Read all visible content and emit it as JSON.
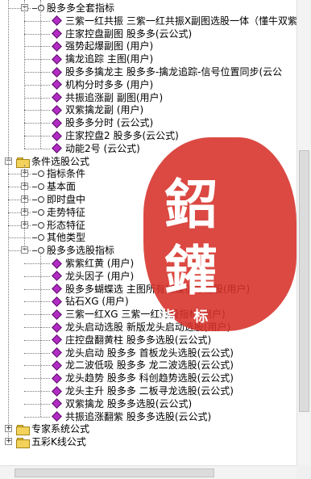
{
  "tree": {
    "items": [
      {
        "label": "股多多全套指标",
        "level": 1,
        "icon": "ring-icon",
        "expand": "−"
      },
      {
        "label": "三紫一红共振   三紫一红共振X副图选股一体（懂牛双紫",
        "level": 2,
        "icon": "diamond-icon"
      },
      {
        "label": "庄家控盘副图   股多多(云公式)",
        "level": 2,
        "icon": "diamond-icon"
      },
      {
        "label": "强势起爆副图  (用户)",
        "level": 2,
        "icon": "diamond-icon"
      },
      {
        "label": "擒龙追踪   主图(用户)",
        "level": 2,
        "icon": "diamond-icon"
      },
      {
        "label": "股多多擒龙主   股多多-擒龙追踪-信号位置同步(云公",
        "level": 2,
        "icon": "diamond-icon"
      },
      {
        "label": "机构分时多多   (用户)",
        "level": 2,
        "icon": "diamond-icon"
      },
      {
        "label": "共振追涨副   副图(用户)",
        "level": 2,
        "icon": "diamond-icon"
      },
      {
        "label": "双紫擒龙副   (用户)",
        "level": 2,
        "icon": "diamond-icon"
      },
      {
        "label": "股多多分时   (云公式)",
        "level": 2,
        "icon": "diamond-icon"
      },
      {
        "label": "庄家控盘2   股多多(云公式)",
        "level": 2,
        "icon": "diamond-icon"
      },
      {
        "label": "动能2号   (云公式)",
        "level": 2,
        "icon": "diamond-icon"
      },
      {
        "label": "条件选股公式",
        "level": 0,
        "icon": "folder-icon",
        "expand": "−"
      },
      {
        "label": "指标条件",
        "level": 1,
        "icon": "ring-icon",
        "expand": "+"
      },
      {
        "label": "基本面",
        "level": 1,
        "icon": "ring-icon",
        "expand": "+"
      },
      {
        "label": "即时盘中",
        "level": 1,
        "icon": "ring-icon",
        "expand": "+"
      },
      {
        "label": "走势特征",
        "level": 1,
        "icon": "ring-icon",
        "expand": "+"
      },
      {
        "label": "形态特征",
        "level": 1,
        "icon": "ring-icon",
        "expand": "+"
      },
      {
        "label": "其他类型",
        "level": 1,
        "icon": "ring-icon"
      },
      {
        "label": "股多多选股指标",
        "level": 1,
        "icon": "ring-icon",
        "expand": "−"
      },
      {
        "label": "紫紫红黄   (用户)",
        "level": 2,
        "icon": "diamond-icon"
      },
      {
        "label": "龙头因子   (用户)",
        "level": 2,
        "icon": "diamond-icon"
      },
      {
        "label": "股多多蝴蝶选   主图所有蝴蝶信号选股(用户)",
        "level": 2,
        "icon": "diamond-icon"
      },
      {
        "label": "钻石XG   (用户)",
        "level": 2,
        "icon": "diamond-icon"
      },
      {
        "label": "三紫一红XG   三紫一红选股指标(用户)",
        "level": 2,
        "icon": "diamond-icon"
      },
      {
        "label": "龙头启动选股   新版龙头启动选股(用户)",
        "level": 2,
        "icon": "diamond-icon"
      },
      {
        "label": "庄控盘翻黄柱   股多多选股(云公式)",
        "level": 2,
        "icon": "diamond-icon"
      },
      {
        "label": "龙头启动   股多多 首板龙头选股(云公式)",
        "level": 2,
        "icon": "diamond-icon"
      },
      {
        "label": "龙二波低吸   股多多 龙二波选股(云公式)",
        "level": 2,
        "icon": "diamond-icon"
      },
      {
        "label": "龙头趋势   股多多 科创趋势选股(云公式)",
        "level": 2,
        "icon": "diamond-icon"
      },
      {
        "label": "龙头主升   股多多 二板寻龙选股(云公式)",
        "level": 2,
        "icon": "diamond-icon"
      },
      {
        "label": "双紫擒龙   股多多选股(云公式)",
        "level": 2,
        "icon": "diamond-icon"
      },
      {
        "label": "共振追涨翻紫   股多多选股(云公式)",
        "level": 2,
        "icon": "diamond-icon"
      },
      {
        "label": "专家系统公式",
        "level": 0,
        "icon": "folder-icon",
        "expand": "+"
      },
      {
        "label": "五彩K线公式",
        "level": 0,
        "icon": "folder-icon",
        "expand": "+"
      }
    ]
  },
  "watermark": {
    "char1": "鉊",
    "char2": "鑵",
    "text": "指 标"
  },
  "colors": {
    "diamond": "#b22cc4",
    "folder": "#f2d25a",
    "stamp": "#d63028"
  }
}
